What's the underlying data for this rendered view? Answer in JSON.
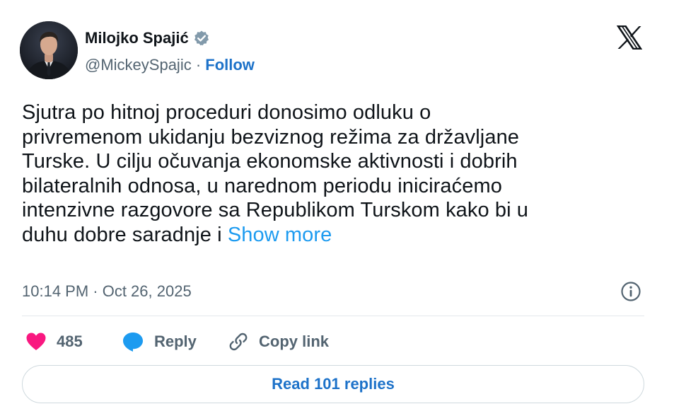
{
  "author": {
    "display_name": "Milojko Spajić",
    "handle": "@MickeySpajic",
    "separator": " · ",
    "follow_label": "Follow",
    "verified_icon": "verified-badge-icon",
    "verified_color": "#829aab"
  },
  "platform_icon": "x-logo-icon",
  "tweet": {
    "lines": [
      "Sjutra po hitnoj proceduri donosimo odluku o",
      "privremenom ukidanju bezviznog režima za državljane",
      "Turske. U cilju očuvanja ekonomske aktivnosti i dobrih",
      "bilateralnih odnosa, u narednom periodu iniciraćemo",
      "intenzivne razgovore sa Republikom Turskom kako bi u",
      "duhu dobre saradnje i "
    ],
    "show_more_label": "Show more",
    "timestamp": "10:14 PM · Oct 26, 2025"
  },
  "actions": {
    "like_count": "485",
    "reply_label": "Reply",
    "copy_link_label": "Copy link",
    "like_color": "#f91880",
    "reply_color": "#1d9bf0"
  },
  "read_replies_label": "Read 101 replies",
  "colors": {
    "link": "#1d9bf0",
    "secondary_text": "#536471",
    "primary_text": "#0f1419"
  }
}
